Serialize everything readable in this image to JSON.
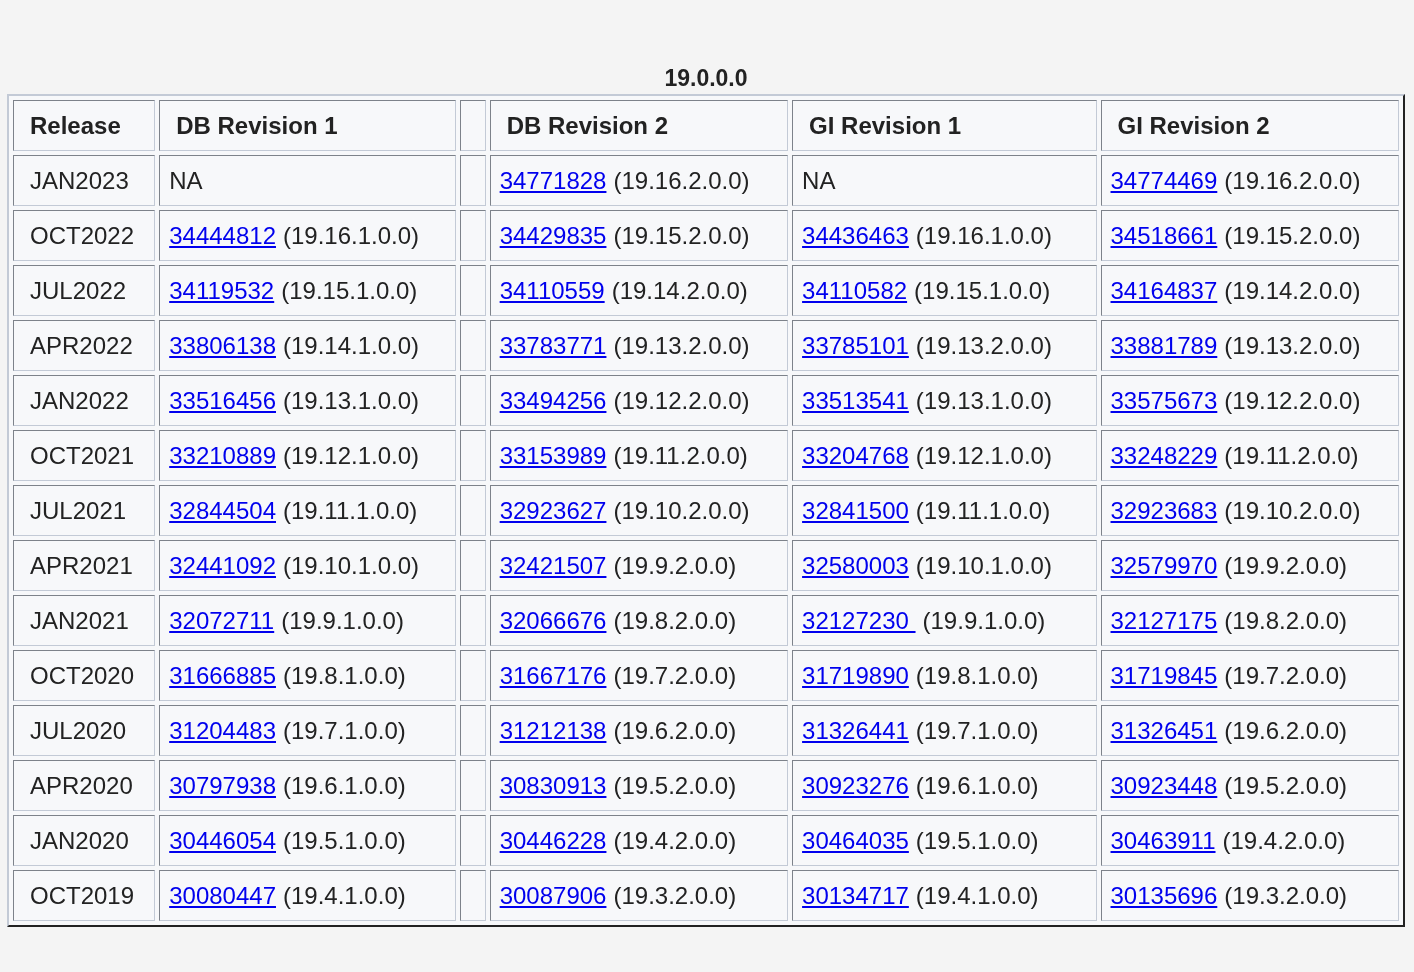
{
  "title": "19.0.0.0",
  "columns": [
    {
      "kind": "text",
      "label": "Release"
    },
    {
      "kind": "text",
      "label": "DB Revision 1"
    },
    {
      "kind": "spacer"
    },
    {
      "kind": "text",
      "label": "DB Revision 2"
    },
    {
      "kind": "text",
      "label": "GI Revision 1"
    },
    {
      "kind": "text",
      "label": "GI Revision 2"
    }
  ],
  "rows": [
    {
      "release": "JAN2023",
      "cells": [
        {
          "kind": "text",
          "text": "NA"
        },
        {
          "kind": "spacer"
        },
        {
          "kind": "link",
          "link": "34771828",
          "version": "(19.16.2.0.0)"
        },
        {
          "kind": "text",
          "text": "NA"
        },
        {
          "kind": "link",
          "link": "34774469",
          "version": "(19.16.2.0.0)"
        }
      ]
    },
    {
      "release": "OCT2022",
      "cells": [
        {
          "kind": "link",
          "link": "34444812",
          "version": "(19.16.1.0.0)"
        },
        {
          "kind": "spacer"
        },
        {
          "kind": "link",
          "link": "34429835",
          "version": "(19.15.2.0.0)"
        },
        {
          "kind": "link",
          "link": "34436463",
          "version": "(19.16.1.0.0)"
        },
        {
          "kind": "link",
          "link": "34518661",
          "version": "(19.15.2.0.0)"
        }
      ]
    },
    {
      "release": "JUL2022",
      "cells": [
        {
          "kind": "link",
          "link": "34119532",
          "version": "(19.15.1.0.0)"
        },
        {
          "kind": "spacer"
        },
        {
          "kind": "link",
          "link": "34110559",
          "version": "(19.14.2.0.0)"
        },
        {
          "kind": "link",
          "link": "34110582",
          "version": "(19.15.1.0.0)"
        },
        {
          "kind": "link",
          "link": "34164837",
          "version": "(19.14.2.0.0)"
        }
      ]
    },
    {
      "release": "APR2022",
      "cells": [
        {
          "kind": "link",
          "link": "33806138",
          "version": "(19.14.1.0.0)"
        },
        {
          "kind": "spacer"
        },
        {
          "kind": "link",
          "link": "33783771",
          "version": "(19.13.2.0.0)"
        },
        {
          "kind": "link",
          "link": "33785101",
          "version": "(19.13.2.0.0)"
        },
        {
          "kind": "link",
          "link": "33881789",
          "version": "(19.13.2.0.0)"
        }
      ]
    },
    {
      "release": "JAN2022",
      "cells": [
        {
          "kind": "link",
          "link": "33516456",
          "version": "(19.13.1.0.0)"
        },
        {
          "kind": "spacer"
        },
        {
          "kind": "link",
          "link": "33494256",
          "version": "(19.12.2.0.0)"
        },
        {
          "kind": "link",
          "link": "33513541",
          "version": "(19.13.1.0.0)"
        },
        {
          "kind": "link",
          "link": "33575673",
          "version": "(19.12.2.0.0)"
        }
      ]
    },
    {
      "release": "OCT2021",
      "cells": [
        {
          "kind": "link",
          "link": "33210889",
          "version": "(19.12.1.0.0)"
        },
        {
          "kind": "spacer"
        },
        {
          "kind": "link",
          "link": "33153989",
          "version": "(19.11.2.0.0)"
        },
        {
          "kind": "link",
          "link": "33204768",
          "version": "(19.12.1.0.0)"
        },
        {
          "kind": "link",
          "link": "33248229",
          "version": "(19.11.2.0.0)"
        }
      ]
    },
    {
      "release": "JUL2021",
      "cells": [
        {
          "kind": "link",
          "link": "32844504",
          "version": "(19.11.1.0.0)"
        },
        {
          "kind": "spacer"
        },
        {
          "kind": "link",
          "link": "32923627",
          "version": "(19.10.2.0.0)"
        },
        {
          "kind": "link",
          "link": "32841500",
          "version": "(19.11.1.0.0)"
        },
        {
          "kind": "link",
          "link": "32923683",
          "version": "(19.10.2.0.0)"
        }
      ]
    },
    {
      "release": "APR2021",
      "cells": [
        {
          "kind": "link",
          "link": "32441092",
          "version": "(19.10.1.0.0)"
        },
        {
          "kind": "spacer"
        },
        {
          "kind": "link",
          "link": "32421507",
          "version": "(19.9.2.0.0)"
        },
        {
          "kind": "link",
          "link": "32580003",
          "version": "(19.10.1.0.0)"
        },
        {
          "kind": "link",
          "link": "32579970",
          "version": "(19.9.2.0.0)"
        }
      ]
    },
    {
      "release": "JAN2021",
      "cells": [
        {
          "kind": "link",
          "link": "32072711",
          "version": "(19.9.1.0.0)"
        },
        {
          "kind": "spacer"
        },
        {
          "kind": "link",
          "link": "32066676",
          "version": "(19.8.2.0.0)"
        },
        {
          "kind": "link",
          "link": "32127230 ",
          "version": "(19.9.1.0.0)"
        },
        {
          "kind": "link",
          "link": "32127175",
          "version": "(19.8.2.0.0)"
        }
      ]
    },
    {
      "release": "OCT2020",
      "cells": [
        {
          "kind": "link",
          "link": "31666885",
          "version": "(19.8.1.0.0)"
        },
        {
          "kind": "spacer"
        },
        {
          "kind": "link",
          "link": "31667176",
          "version": "(19.7.2.0.0)"
        },
        {
          "kind": "link",
          "link": "31719890",
          "version": "(19.8.1.0.0)"
        },
        {
          "kind": "link",
          "link": "31719845",
          "version": "(19.7.2.0.0)"
        }
      ]
    },
    {
      "release": "JUL2020",
      "cells": [
        {
          "kind": "link",
          "link": "31204483",
          "version": "(19.7.1.0.0)"
        },
        {
          "kind": "spacer"
        },
        {
          "kind": "link",
          "link": "31212138",
          "version": "(19.6.2.0.0)"
        },
        {
          "kind": "link",
          "link": "31326441",
          "version": "(19.7.1.0.0)"
        },
        {
          "kind": "link",
          "link": "31326451",
          "version": "(19.6.2.0.0)"
        }
      ]
    },
    {
      "release": "APR2020",
      "cells": [
        {
          "kind": "link",
          "link": "30797938",
          "version": "(19.6.1.0.0)"
        },
        {
          "kind": "spacer"
        },
        {
          "kind": "link",
          "link": "30830913",
          "version": "(19.5.2.0.0)"
        },
        {
          "kind": "link",
          "link": "30923276",
          "version": "(19.6.1.0.0)"
        },
        {
          "kind": "link",
          "link": "30923448",
          "version": "(19.5.2.0.0)"
        }
      ]
    },
    {
      "release": "JAN2020",
      "cells": [
        {
          "kind": "link",
          "link": "30446054",
          "version": "(19.5.1.0.0)"
        },
        {
          "kind": "spacer"
        },
        {
          "kind": "link",
          "link": "30446228",
          "version": "(19.4.2.0.0)"
        },
        {
          "kind": "link",
          "link": "30464035",
          "version": "(19.5.1.0.0)"
        },
        {
          "kind": "link",
          "link": "30463911",
          "version": "(19.4.2.0.0)"
        }
      ]
    },
    {
      "release": "OCT2019",
      "cells": [
        {
          "kind": "link",
          "link": "30080447",
          "version": "(19.4.1.0.0)"
        },
        {
          "kind": "spacer"
        },
        {
          "kind": "link",
          "link": "30087906",
          "version": "(19.3.2.0.0)"
        },
        {
          "kind": "link",
          "link": "30134717",
          "version": "(19.4.1.0.0)"
        },
        {
          "kind": "link",
          "link": "30135696",
          "version": "(19.3.2.0.0)"
        }
      ]
    }
  ]
}
